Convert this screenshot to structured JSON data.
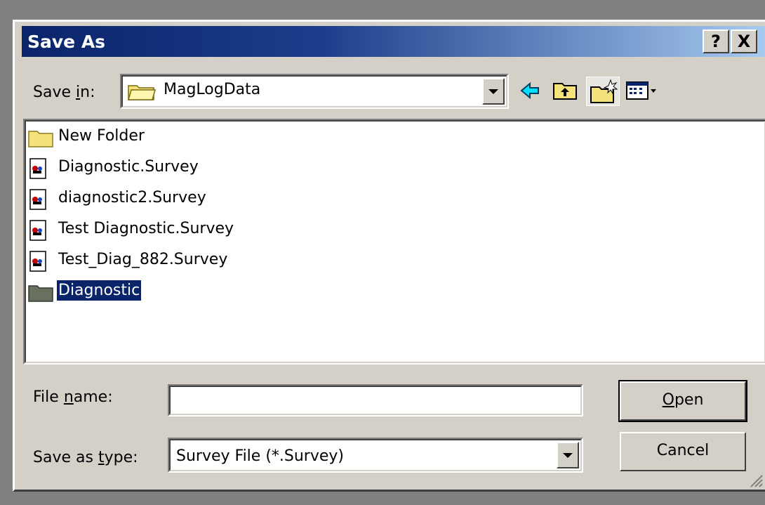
{
  "window": {
    "title": "Save As",
    "help_label": "?",
    "close_label": "X"
  },
  "save_in": {
    "label_prefix": "Save ",
    "label_mnemonic": "i",
    "label_suffix": "n:",
    "value": "MagLogData"
  },
  "toolbar": {
    "icons": [
      "back-icon",
      "up-folder-icon",
      "new-folder-icon",
      "view-menu-icon"
    ]
  },
  "files": [
    {
      "name": "New Folder",
      "type": "folder"
    },
    {
      "name": "Diagnostic.Survey",
      "type": "survey"
    },
    {
      "name": "diagnostic2.Survey",
      "type": "survey"
    },
    {
      "name": "Test Diagnostic.Survey",
      "type": "survey"
    },
    {
      "name": "Test_Diag_882.Survey",
      "type": "survey"
    },
    {
      "name": "Diagnostic",
      "type": "folder",
      "selected": true
    }
  ],
  "file_name": {
    "label_prefix": "File ",
    "label_mnemonic": "n",
    "label_suffix": "ame:",
    "value": ""
  },
  "save_as_type": {
    "label_prefix": "Save as ",
    "label_mnemonic": "t",
    "label_suffix": "ype:",
    "value": "Survey File (*.Survey)"
  },
  "buttons": {
    "open_mnemonic": "O",
    "open_rest": "pen",
    "cancel": "Cancel"
  },
  "colors": {
    "titlebar": "#0a246a",
    "face": "#d4d0c8",
    "selection": "#0a246a"
  }
}
